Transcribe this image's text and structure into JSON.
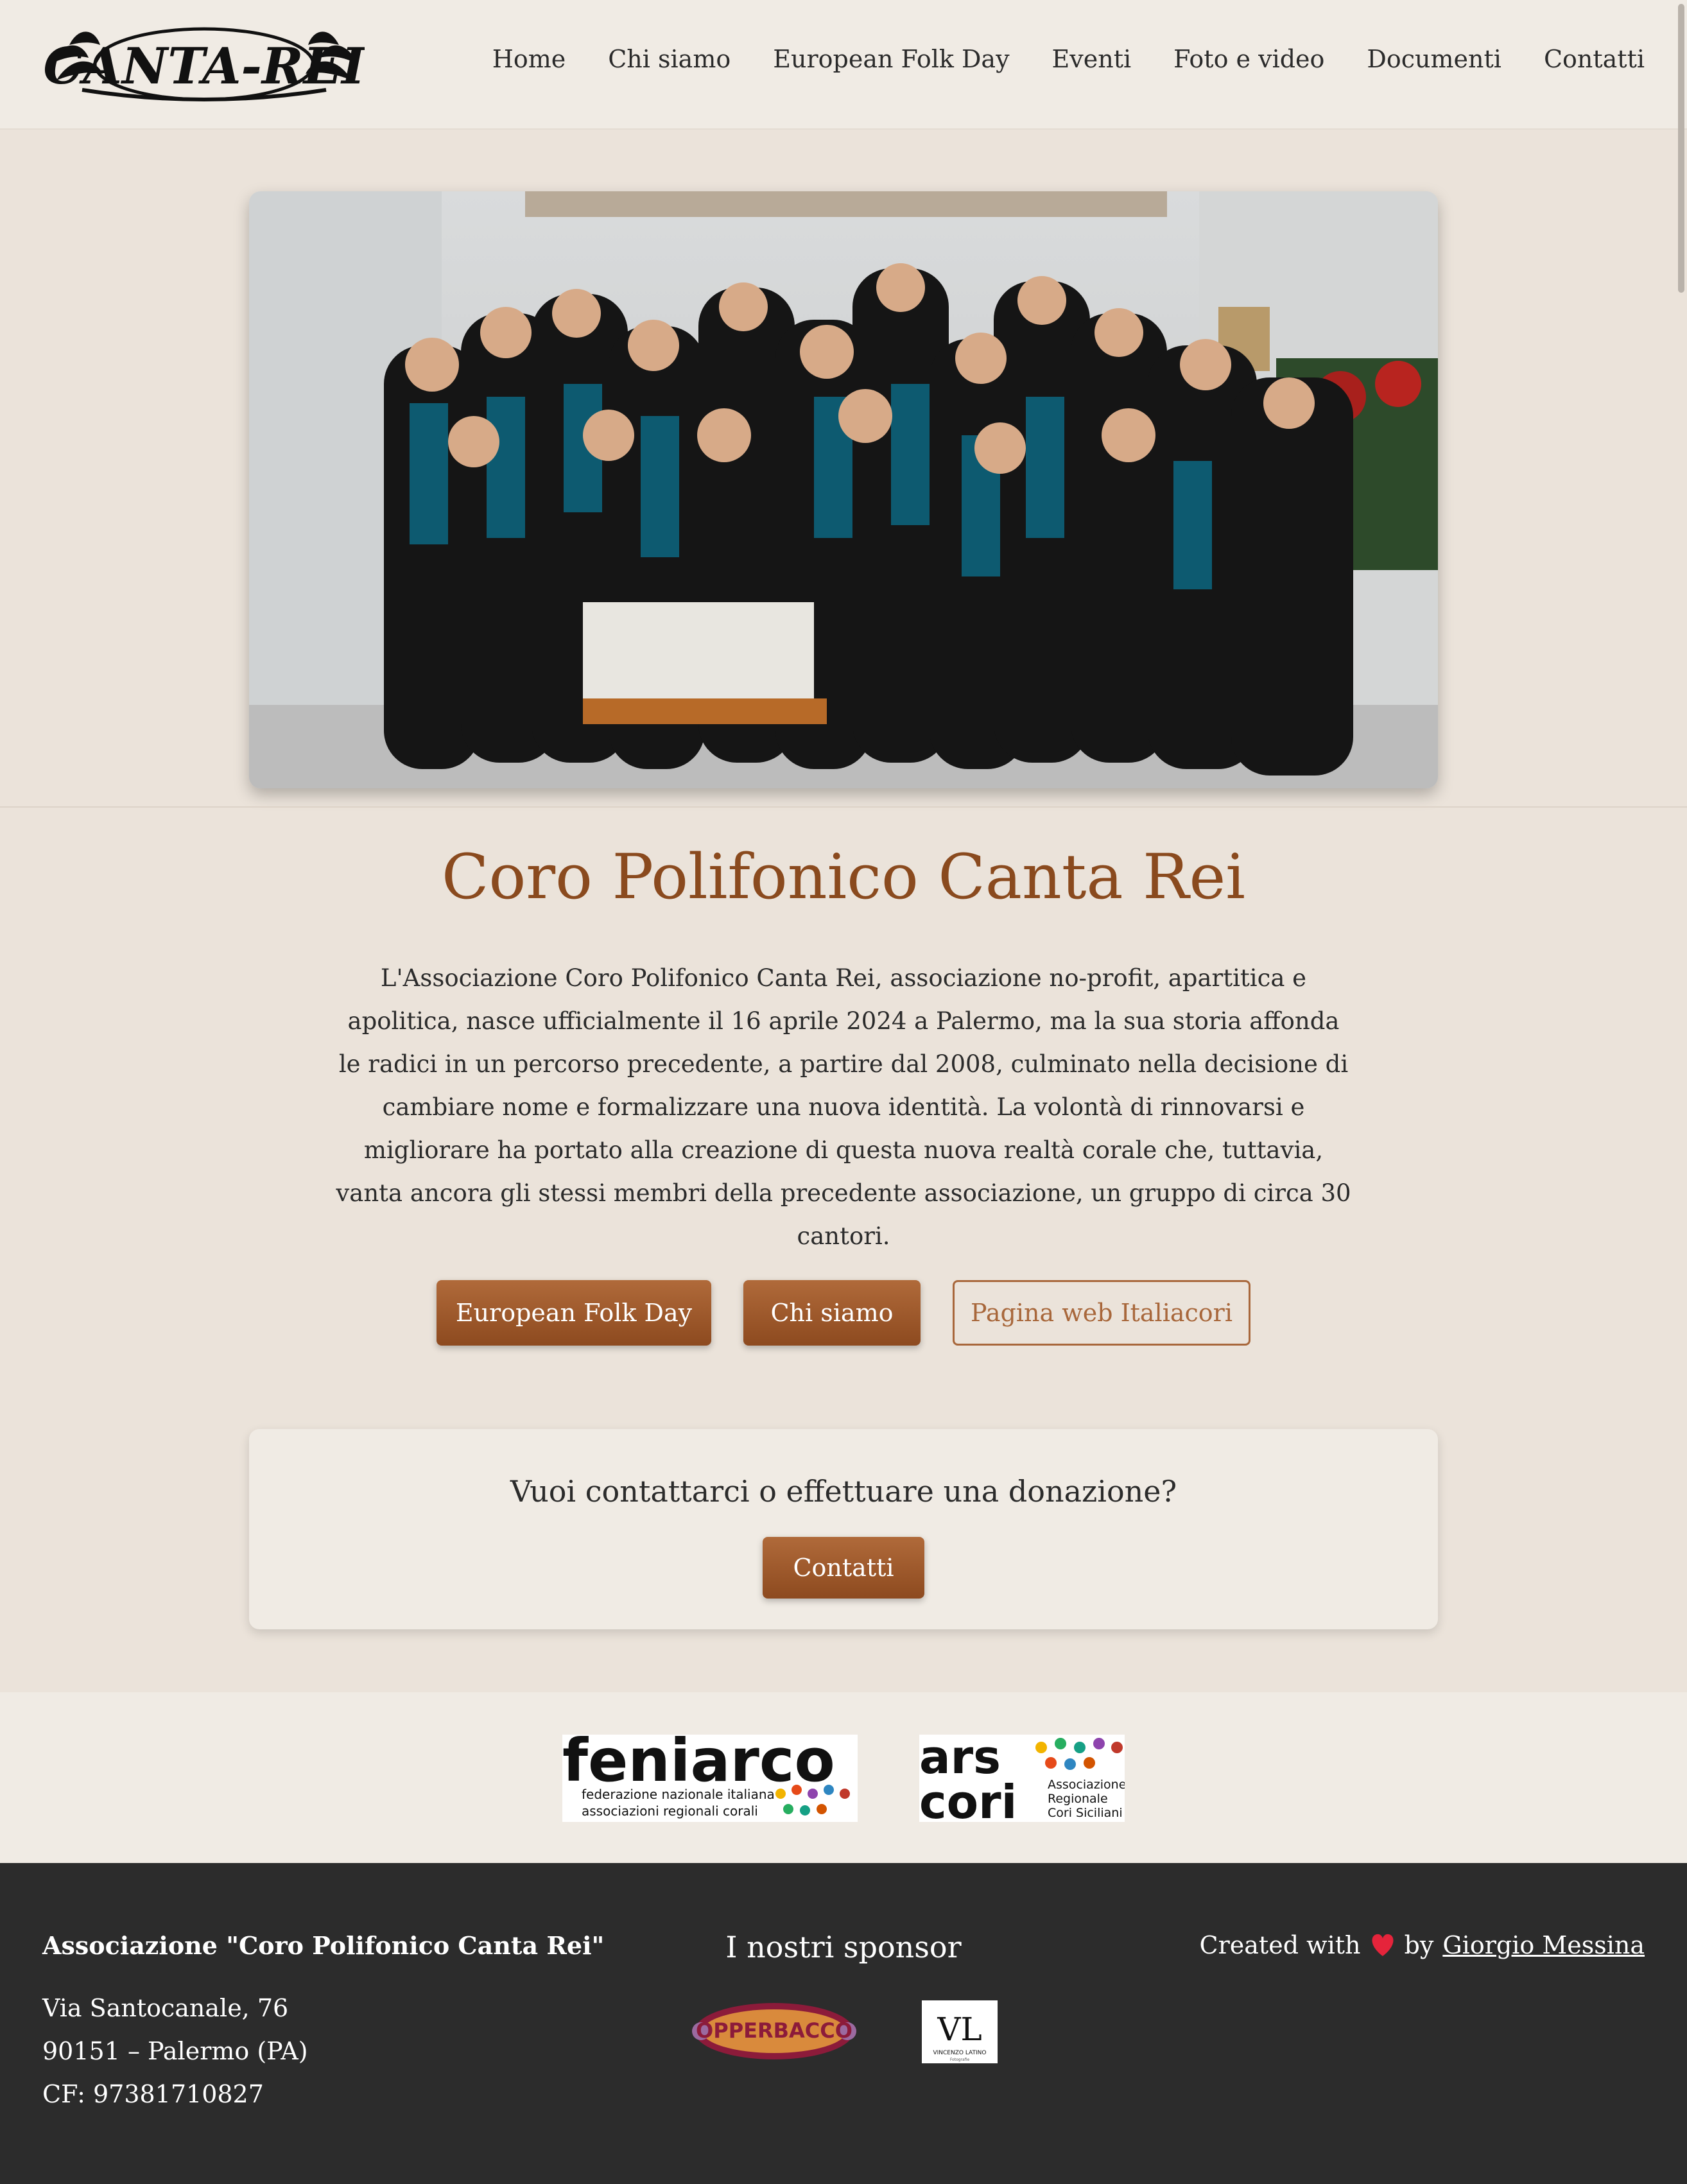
{
  "header": {
    "logo_text": "CANTA-REI",
    "nav": [
      "Home",
      "Chi siamo",
      "European Folk Day",
      "Eventi",
      "Foto e video",
      "Documenti",
      "Contatti"
    ]
  },
  "main": {
    "title": "Coro Polifonico Canta Rei",
    "intro": "L'Associazione Coro Polifonico Canta Rei, associazione no-profit, apartitica e apolitica, nasce ufficialmente il 16 aprile 2024 a Palermo, ma la sua storia affonda le radici in un percorso precedente, a partire dal 2008, culminato nella decisione di cambiare nome e formalizzare una nuova identità. La volontà di rinnovarsi e migliorare ha portato alla creazione di questa nuova realtà corale che, tuttavia, vanta ancora gli stessi membri della precedente associazione, un gruppo di circa 30 cantori.",
    "buttons": {
      "folk_day": "European Folk Day",
      "chi_siamo": "Chi siamo",
      "italiacori": "Pagina web Italiacori"
    }
  },
  "contact": {
    "question": "Vuoi contattarci o effettuare una donazione?",
    "button": "Contatti"
  },
  "partners": {
    "feniarco": {
      "name": "feniarco",
      "line1": "federazione nazionale italiana",
      "line2": "associazioni regionali corali"
    },
    "arscori": {
      "name_top": "ars",
      "name_bottom": "cori",
      "line1": "Associazione",
      "line2": "Regionale",
      "line3": "Cori Siciliani"
    }
  },
  "footer": {
    "assoc_name": "Associazione \"Coro Polifonico Canta Rei\"",
    "address1": "Via Santocanale, 76",
    "address2": "90151 – Palermo (PA)",
    "cf": "CF: 97381710827",
    "sponsors_title": "I nostri sponsor",
    "sponsor1": "OPPERBACCO",
    "sponsor2_mark": "VL",
    "sponsor2_name": "VINCENZO LATINO",
    "sponsor2_sub": "Fotografie",
    "credit_prefix": "Created with",
    "credit_by": "by",
    "credit_author": "Giorgio Messina"
  },
  "colors": {
    "accent": "#8a4a1e",
    "page_bg": "#ebe3da",
    "header_bg": "#f0ebe4",
    "footer_bg": "#2c2c2c"
  }
}
